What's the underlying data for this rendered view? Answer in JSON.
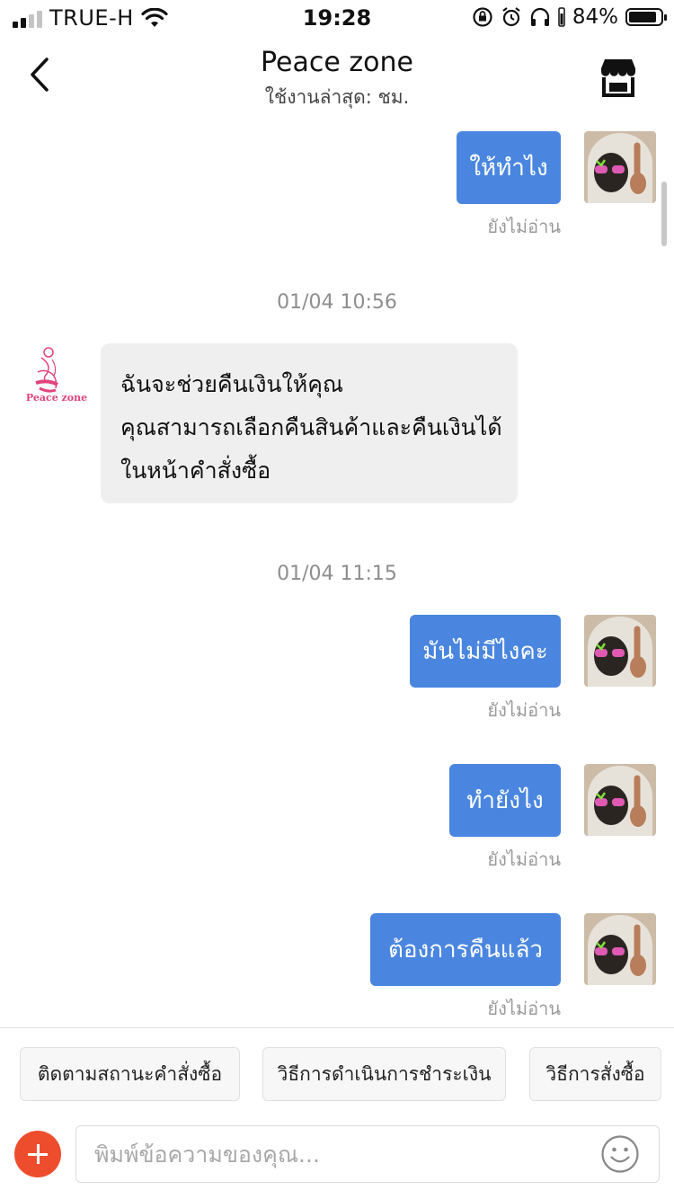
{
  "status_bar": {
    "carrier": "TRUE-H",
    "time": "19:28",
    "battery": "84%"
  },
  "header": {
    "title": "Peace zone",
    "subtitle": "ใช้งานล่าสุด: ชม."
  },
  "shop_logo_text": "Peace zone",
  "messages": [
    {
      "text": "ให้ทำไง",
      "status": "ยังไม่อ่าน"
    },
    {
      "timestamp": "01/04 10:56"
    },
    {
      "lines": [
        "ฉันจะช่วยคืนเงินให้คุณ",
        "คุณสามารถเลือกคืนสินค้าและคืนเงินได้",
        "ในหน้าคำสั่งซื้อ"
      ]
    },
    {
      "timestamp": "01/04 11:15"
    },
    {
      "text": "มันไม่มีไงคะ",
      "status": "ยังไม่อ่าน"
    },
    {
      "text": "ทำยังไง",
      "status": "ยังไม่อ่าน"
    },
    {
      "text": "ต้องการคืนแล้ว",
      "status": "ยังไม่อ่าน"
    }
  ],
  "quick_replies": [
    "ติดตามสถานะคำสั่งซื้อ",
    "วิธีการดำเนินการชำระเงิน",
    "วิธีการสั่งซื้อ"
  ],
  "input": {
    "placeholder": "พิมพ์ข้อความของคุณ..."
  },
  "colors": {
    "outgoing_bubble": "#4a86e0",
    "incoming_bubble": "#efefef",
    "accent": "#ee4d2d"
  },
  "icons": [
    "back-icon",
    "shop-icon",
    "add-icon",
    "emoji-icon",
    "wifi-icon",
    "lock-rotation-icon",
    "alarm-icon",
    "headphones-icon",
    "battery-icon"
  ]
}
